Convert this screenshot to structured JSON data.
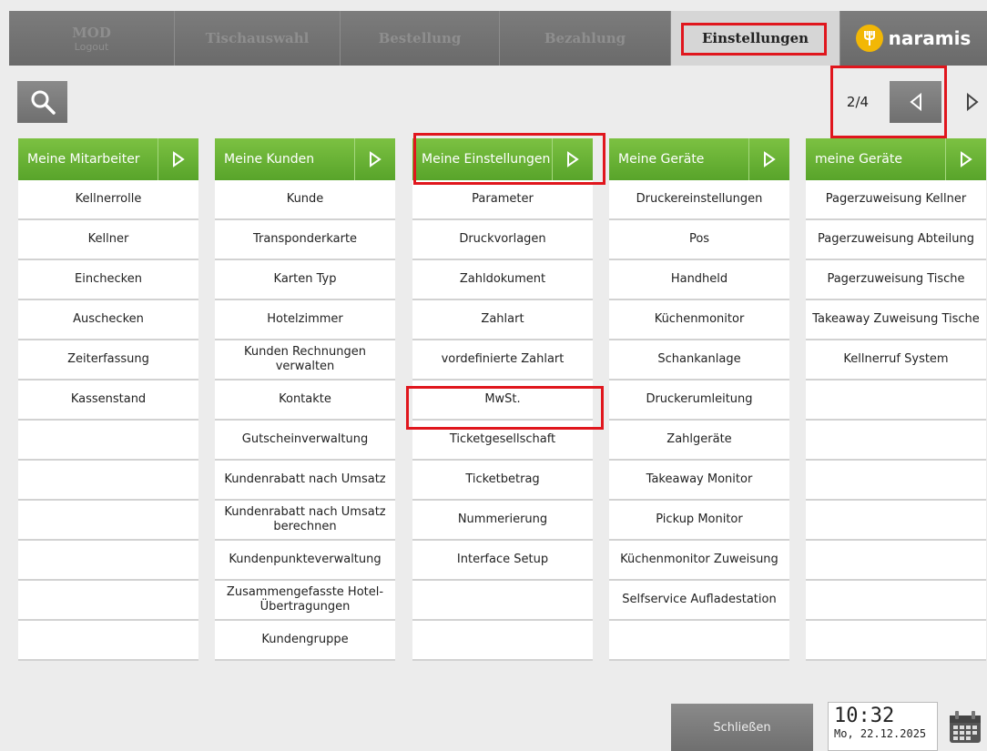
{
  "topbar": {
    "tabs": [
      {
        "label": "MOD",
        "sub": "Logout"
      },
      {
        "label": "Tischauswahl"
      },
      {
        "label": "Bestellung"
      },
      {
        "label": "Bezahlung"
      },
      {
        "label": "Einstellungen"
      }
    ],
    "logo": "naramis"
  },
  "pager": {
    "page": "2/4"
  },
  "columns": [
    {
      "title": "Meine Mitarbeiter",
      "items": [
        "Kellnerrolle",
        "Kellner",
        "Einchecken",
        "Auschecken",
        "Zeiterfassung",
        "Kassenstand",
        "",
        "",
        "",
        "",
        "",
        ""
      ]
    },
    {
      "title": "Meine Kunden",
      "items": [
        "Kunde",
        "Transponderkarte",
        "Karten Typ",
        "Hotelzimmer",
        "Kunden Rechnungen verwalten",
        "Kontakte",
        "Gutscheinverwaltung",
        "Kundenrabatt nach Umsatz",
        "Kundenrabatt nach Umsatz berechnen",
        "Kundenpunkteverwaltung",
        "Zusammengefasste Hotel-Übertragungen",
        "Kundengruppe"
      ]
    },
    {
      "title": "Meine Einstellungen",
      "items": [
        "Parameter",
        "Druckvorlagen",
        "Zahldokument",
        "Zahlart",
        "vordefinierte Zahlart",
        "MwSt.",
        "Ticketgesellschaft",
        "Ticketbetrag",
        "Nummerierung",
        "Interface Setup",
        "",
        ""
      ]
    },
    {
      "title": "Meine Geräte",
      "items": [
        "Druckereinstellungen",
        "Pos",
        "Handheld",
        "Küchenmonitor",
        "Schankanlage",
        "Druckerumleitung",
        "Zahlgeräte",
        "Takeaway Monitor",
        "Pickup Monitor",
        "Küchenmonitor Zuweisung",
        "Selfservice Aufladestation",
        ""
      ]
    },
    {
      "title": "meine Geräte",
      "items": [
        "Pagerzuweisung Kellner",
        "Pagerzuweisung Abteilung",
        "Pagerzuweisung Tische",
        "Takeaway Zuweisung Tische",
        "Kellnerruf System",
        "",
        "",
        "",
        "",
        "",
        "",
        ""
      ]
    }
  ],
  "footer": {
    "close_label": "Schließen",
    "time": "10:32",
    "date": "Mo, 22.12.2025"
  },
  "colors": {
    "green_header": "#6cb535",
    "highlight": "#e0161d",
    "logo_accent": "#f2b705"
  },
  "icons": [
    "search-icon",
    "arrow-left-icon",
    "arrow-right-icon",
    "calendar-icon",
    "fork-icon"
  ]
}
